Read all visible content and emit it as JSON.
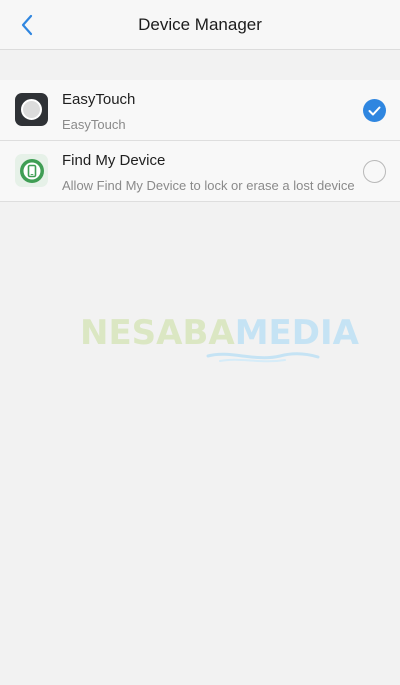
{
  "header": {
    "title": "Device Manager",
    "back_icon": "chevron-left-icon",
    "accent": "#2f86e0"
  },
  "items": [
    {
      "title": "EasyTouch",
      "subtitle": "EasyTouch",
      "icon": "easytouch-app-icon",
      "checked": true
    },
    {
      "title": "Find My Device",
      "subtitle": "Allow Find My Device to lock or erase a lost device",
      "icon": "find-my-device-app-icon",
      "checked": false
    }
  ],
  "watermark": {
    "part1": "NESABA",
    "part2": "MEDIA",
    "colors": [
      "#dbe7c3",
      "#c5e3f4"
    ]
  }
}
